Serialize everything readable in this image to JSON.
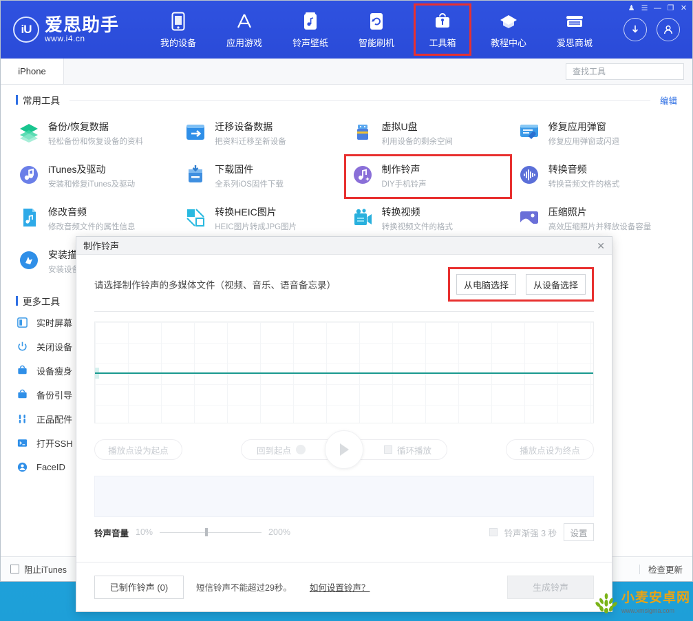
{
  "app": {
    "logo_name": "爱思助手",
    "logo_url": "www.i4.cn",
    "logo_mark": "iU"
  },
  "window_controls": [
    {
      "name": "trophy-icon",
      "glyph": "♟"
    },
    {
      "name": "menu-icon",
      "glyph": "☰"
    },
    {
      "name": "minimize-icon",
      "glyph": "—"
    },
    {
      "name": "maximize-icon",
      "glyph": "❐"
    },
    {
      "name": "close-icon",
      "glyph": "✕"
    }
  ],
  "nav": [
    {
      "label": "我的设备",
      "icon": "phone-icon"
    },
    {
      "label": "应用游戏",
      "icon": "appstore-icon"
    },
    {
      "label": "铃声壁纸",
      "icon": "ringtone-icon"
    },
    {
      "label": "智能刷机",
      "icon": "flash-icon"
    },
    {
      "label": "工具箱",
      "icon": "toolbox-icon",
      "highlighted": true
    },
    {
      "label": "教程中心",
      "icon": "graduation-icon"
    },
    {
      "label": "爱思商城",
      "icon": "store-icon"
    }
  ],
  "header_right": [
    {
      "name": "download-button",
      "glyph": "↓"
    },
    {
      "name": "account-button",
      "glyph": "☻"
    }
  ],
  "tabbar": {
    "device_tab": "iPhone"
  },
  "search": {
    "placeholder": "查找工具",
    "value": ""
  },
  "common_tools": {
    "title": "常用工具",
    "edit_label": "编辑",
    "items": [
      {
        "title": "备份/恢复数据",
        "desc": "轻松备份和恢复设备的资料",
        "icon": "layers-icon",
        "color": "#18c58f"
      },
      {
        "title": "迁移设备数据",
        "desc": "把资料迁移至新设备",
        "icon": "transfer-icon",
        "color": "#2f8fe8"
      },
      {
        "title": "虚拟U盘",
        "desc": "利用设备的剩余空间",
        "icon": "usb-icon",
        "color": "#4a7fe0"
      },
      {
        "title": "修复应用弹窗",
        "desc": "修复应用弹窗或闪退",
        "icon": "wrench-window-icon",
        "color": "#3b9ae8"
      },
      {
        "title": "iTunes及驱动",
        "desc": "安装和修复iTunes及驱动",
        "icon": "music-note-icon",
        "color": "#6b7fe8"
      },
      {
        "title": "下载固件",
        "desc": "全系列iOS固件下载",
        "icon": "firmware-icon",
        "color": "#3f8fe0"
      },
      {
        "title": "制作铃声",
        "desc": "DIY手机铃声",
        "icon": "ringtone-make-icon",
        "color": "#8a6fd8",
        "highlighted": true
      },
      {
        "title": "转换音频",
        "desc": "转换音频文件的格式",
        "icon": "audio-wave-icon",
        "color": "#5b6fd8"
      },
      {
        "title": "修改音频",
        "desc": "修改音频文件的属性信息",
        "icon": "audio-file-icon",
        "color": "#2eaae8"
      },
      {
        "title": "转换HEIC图片",
        "desc": "HEIC图片转成JPG图片",
        "icon": "heic-icon",
        "color": "#29b9e0"
      },
      {
        "title": "转换视频",
        "desc": "转换视频文件的格式",
        "icon": "video-icon",
        "color": "#29b0dd"
      },
      {
        "title": "压缩照片",
        "desc": "高效压缩照片并释放设备容量",
        "icon": "photo-icon",
        "color": "#6a6fd8"
      },
      {
        "title": "安装描述文件",
        "desc": "安装设备描述文件",
        "icon": "install-icon",
        "color": "#2f8fe8"
      }
    ]
  },
  "more_tools": {
    "title": "更多工具",
    "items": [
      {
        "label": "实时屏幕",
        "icon": "screen-icon"
      },
      {
        "label": "关闭设备",
        "icon": "power-icon"
      },
      {
        "label": "设备瘦身",
        "icon": "slim-icon"
      },
      {
        "label": "备份引导",
        "icon": "backup-icon"
      },
      {
        "label": "正品配件",
        "icon": "accessory-icon"
      },
      {
        "label": "打开SSH",
        "icon": "terminal-icon"
      },
      {
        "label": "FaceID",
        "icon": "faceid-icon"
      }
    ]
  },
  "statusbar": {
    "block_itunes_label": "阻止iTunes",
    "check_update_label": "检查更新"
  },
  "modal": {
    "title": "制作铃声",
    "close_glyph": "✕",
    "prompt": "请选择制作铃声的多媒体文件（视频、音乐、语音备忘录）",
    "pick_from_computer": "从电脑选择",
    "pick_from_device": "从设备选择",
    "transport": {
      "set_start": "播放点设为起点",
      "back_to_start": "回到起点",
      "loop_play": "循环播放",
      "set_end": "播放点设为终点",
      "play_glyph": "▶"
    },
    "volume": {
      "label": "铃声音量",
      "min": "10%",
      "max": "200%",
      "value_percent": 45
    },
    "fade": {
      "label": "铃声渐强 3 秒",
      "settings_button": "设置",
      "checked": true
    },
    "footer": {
      "made_button": "已制作铃声 (0)",
      "note": "短信铃声不能超过29秒。",
      "link": "如何设置铃声？",
      "generate_button": "生成铃声"
    }
  },
  "watermark": {
    "main": "小麦安卓网",
    "sub": "www.xmsigma.com"
  },
  "colors": {
    "header_blue": "#2e4fdd",
    "accent_red": "#e8302f",
    "link_blue": "#2f6fe4",
    "wave_line": "#18998f",
    "desktop": "#29b6e8"
  }
}
